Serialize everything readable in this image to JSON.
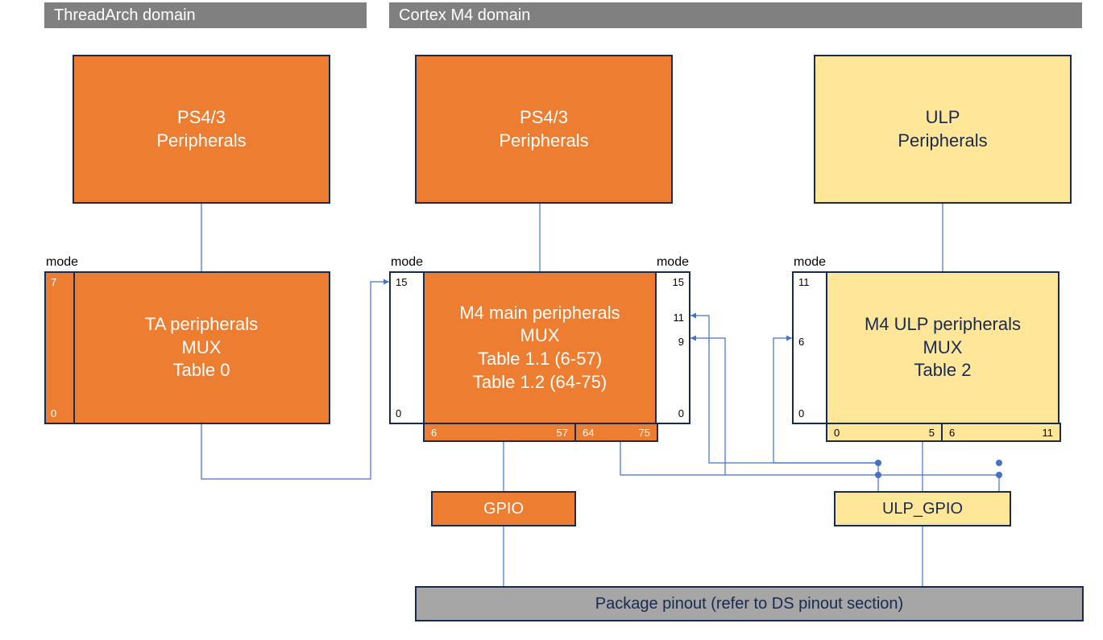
{
  "domains": {
    "threadarch": "ThreadArch domain",
    "cortexm4": "Cortex M4 domain"
  },
  "labels": {
    "mode": "mode"
  },
  "blocks": {
    "ta_ps43": {
      "line1": "PS4/3",
      "line2": "Peripherals"
    },
    "ta_mux": {
      "line1": "TA peripherals",
      "line2": "MUX",
      "line3": "Table 0"
    },
    "m4_ps43": {
      "line1": "PS4/3",
      "line2": "Peripherals"
    },
    "m4_mux": {
      "line1": "M4 main peripherals",
      "line2": "MUX",
      "line3": "Table 1.1 (6-57)",
      "line4": "Table 1.2 (64-75)"
    },
    "ulp_periph": {
      "line1": "ULP",
      "line2": "Peripherals"
    },
    "ulp_mux": {
      "line1": "M4 ULP peripherals",
      "line2": "MUX",
      "line3": "Table 2"
    },
    "gpio": "GPIO",
    "ulp_gpio": "ULP_GPIO",
    "pinout": "Package pinout (refer to DS pinout section)"
  },
  "mode_ticks": {
    "ta": {
      "top": "7",
      "bottom": "0"
    },
    "m4_left": {
      "top": "15",
      "bottom": "0"
    },
    "m4_right": {
      "a": "15",
      "b": "11",
      "c": "9",
      "bottom": "0"
    },
    "ulp_left": {
      "top": "11",
      "mid": "6",
      "bottom": "0"
    }
  },
  "ranges": {
    "m4": {
      "a1": "6",
      "a2": "57",
      "b1": "64",
      "b2": "75"
    },
    "ulp": {
      "a1": "0",
      "a2": "5",
      "b1": "6",
      "b2": "11"
    }
  },
  "colors": {
    "orange": "#ed7d31",
    "yellow": "#ffe699",
    "gray_header": "#808080",
    "gray_pinout": "#a6a6a6",
    "border": "#172a50",
    "wire": "#4472c4"
  }
}
